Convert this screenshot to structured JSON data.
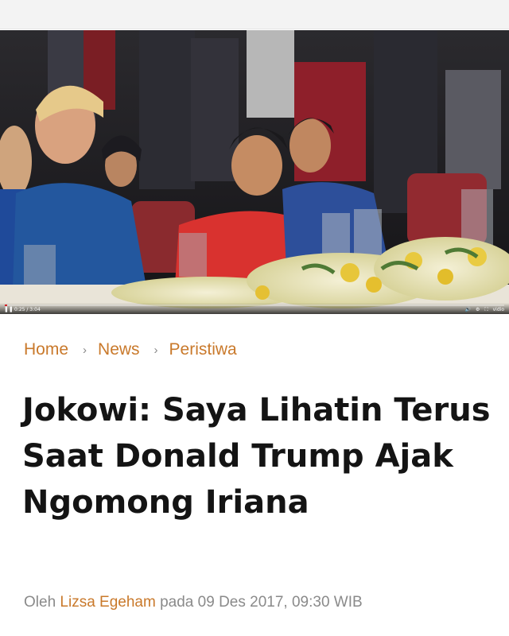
{
  "video": {
    "progress_fraction": 0.005,
    "time_text": "0:25 / 3:04",
    "right_controls": [
      "🔊",
      "⚙",
      "⛶",
      "vidio"
    ]
  },
  "breadcrumb": {
    "items": [
      "Home",
      "News",
      "Peristiwa"
    ],
    "separator": "›"
  },
  "article": {
    "title": "Jokowi: Saya Lihatin Terus Saat Donald Trump Ajak Ngomong Iriana",
    "byline_prefix": "Oleh",
    "author": "Lizsa Egeham",
    "byline_date": "pada 09 Des 2017, 09:30 WIB"
  },
  "colors": {
    "accent": "#c9792b",
    "headline": "#141414",
    "muted": "#8a8a8a"
  }
}
